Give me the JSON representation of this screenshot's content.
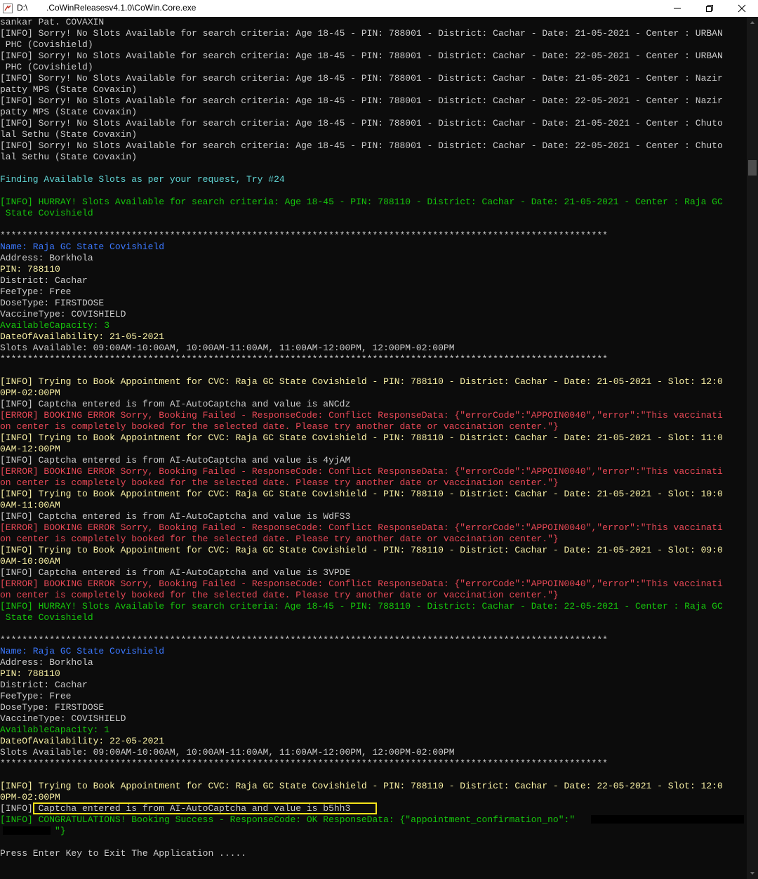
{
  "window": {
    "title": "D:\\        .CoWinReleasesv4.1.0\\CoWin.Core.exe"
  },
  "colors": {
    "background": "#0c0c0c",
    "default": "#cccccc",
    "yellow": "#f9f1a5",
    "green": "#16c60c",
    "red": "#e74856",
    "cyan": "#61d6d6",
    "blue": "#3b78ff",
    "highlight": "#f5e31a"
  },
  "console_lines": [
    {
      "t": "sankar Pat. COVAXIN",
      "c": "white"
    },
    {
      "t": "[INFO] Sorry! No Slots Available for search criteria: Age 18-45 - PIN: 788001 - District: Cachar - Date: 21-05-2021 - Center : URBAN",
      "c": "white"
    },
    {
      "t": " PHC (Covishield)",
      "c": "white"
    },
    {
      "t": "[INFO] Sorry! No Slots Available for search criteria: Age 18-45 - PIN: 788001 - District: Cachar - Date: 22-05-2021 - Center : URBAN",
      "c": "white"
    },
    {
      "t": " PHC (Covishield)",
      "c": "white"
    },
    {
      "t": "[INFO] Sorry! No Slots Available for search criteria: Age 18-45 - PIN: 788001 - District: Cachar - Date: 21-05-2021 - Center : Nazir",
      "c": "white"
    },
    {
      "t": "patty MPS (State Covaxin)",
      "c": "white"
    },
    {
      "t": "[INFO] Sorry! No Slots Available for search criteria: Age 18-45 - PIN: 788001 - District: Cachar - Date: 22-05-2021 - Center : Nazir",
      "c": "white"
    },
    {
      "t": "patty MPS (State Covaxin)",
      "c": "white"
    },
    {
      "t": "[INFO] Sorry! No Slots Available for search criteria: Age 18-45 - PIN: 788001 - District: Cachar - Date: 21-05-2021 - Center : Chuto",
      "c": "white"
    },
    {
      "t": "lal Sethu (State Covaxin)",
      "c": "white"
    },
    {
      "t": "[INFO] Sorry! No Slots Available for search criteria: Age 18-45 - PIN: 788001 - District: Cachar - Date: 22-05-2021 - Center : Chuto",
      "c": "white"
    },
    {
      "t": "lal Sethu (State Covaxin)",
      "c": "white"
    },
    {
      "t": "",
      "c": "white"
    },
    {
      "t": "Finding Available Slots as per your request, Try #24",
      "c": "cyan"
    },
    {
      "t": "",
      "c": "white"
    },
    {
      "t": "[INFO] HURRAY! Slots Available for search criteria: Age 18-45 - PIN: 788110 - District: Cachar - Date: 21-05-2021 - Center : Raja GC",
      "c": "green"
    },
    {
      "t": " State Covishield",
      "c": "green"
    },
    {
      "t": "",
      "c": "white"
    },
    {
      "t": "***************************************************************************************************************",
      "c": "white"
    },
    {
      "t": "Name: Raja GC State Covishield",
      "c": "blue"
    },
    {
      "t": "Address: Borkhola",
      "c": "white"
    },
    {
      "t": "PIN: 788110",
      "c": "yellow"
    },
    {
      "t": "District: Cachar",
      "c": "white"
    },
    {
      "t": "FeeType: Free",
      "c": "white"
    },
    {
      "t": "DoseType: FIRSTDOSE",
      "c": "white"
    },
    {
      "t": "VaccineType: COVISHIELD",
      "c": "white"
    },
    {
      "t": "AvailableCapacity: 3",
      "c": "green"
    },
    {
      "t": "DateOfAvailability: 21-05-2021",
      "c": "yellow"
    },
    {
      "t": "Slots Available: 09:00AM-10:00AM, 10:00AM-11:00AM, 11:00AM-12:00PM, 12:00PM-02:00PM",
      "c": "white"
    },
    {
      "t": "***************************************************************************************************************",
      "c": "white"
    },
    {
      "t": "",
      "c": "white"
    },
    {
      "t": "[INFO] Trying to Book Appointment for CVC: Raja GC State Covishield - PIN: 788110 - District: Cachar - Date: 21-05-2021 - Slot: 12:0",
      "c": "yellow"
    },
    {
      "t": "0PM-02:00PM",
      "c": "yellow"
    },
    {
      "t": "[INFO] Captcha entered is from AI-AutoCaptcha and value is aNCdz",
      "c": "white"
    },
    {
      "t": "[ERROR] BOOKING ERROR Sorry, Booking Failed - ResponseCode: Conflict ResponseData: {\"errorCode\":\"APPOIN0040\",\"error\":\"This vaccinati",
      "c": "red"
    },
    {
      "t": "on center is completely booked for the selected date. Please try another date or vaccination center.\"}",
      "c": "red"
    },
    {
      "t": "[INFO] Trying to Book Appointment for CVC: Raja GC State Covishield - PIN: 788110 - District: Cachar - Date: 21-05-2021 - Slot: 11:0",
      "c": "yellow"
    },
    {
      "t": "0AM-12:00PM",
      "c": "yellow"
    },
    {
      "t": "[INFO] Captcha entered is from AI-AutoCaptcha and value is 4yjAM",
      "c": "white"
    },
    {
      "t": "[ERROR] BOOKING ERROR Sorry, Booking Failed - ResponseCode: Conflict ResponseData: {\"errorCode\":\"APPOIN0040\",\"error\":\"This vaccinati",
      "c": "red"
    },
    {
      "t": "on center is completely booked for the selected date. Please try another date or vaccination center.\"}",
      "c": "red"
    },
    {
      "t": "[INFO] Trying to Book Appointment for CVC: Raja GC State Covishield - PIN: 788110 - District: Cachar - Date: 21-05-2021 - Slot: 10:0",
      "c": "yellow"
    },
    {
      "t": "0AM-11:00AM",
      "c": "yellow"
    },
    {
      "t": "[INFO] Captcha entered is from AI-AutoCaptcha and value is WdFS3",
      "c": "white"
    },
    {
      "t": "[ERROR] BOOKING ERROR Sorry, Booking Failed - ResponseCode: Conflict ResponseData: {\"errorCode\":\"APPOIN0040\",\"error\":\"This vaccinati",
      "c": "red"
    },
    {
      "t": "on center is completely booked for the selected date. Please try another date or vaccination center.\"}",
      "c": "red"
    },
    {
      "t": "[INFO] Trying to Book Appointment for CVC: Raja GC State Covishield - PIN: 788110 - District: Cachar - Date: 21-05-2021 - Slot: 09:0",
      "c": "yellow"
    },
    {
      "t": "0AM-10:00AM",
      "c": "yellow"
    },
    {
      "t": "[INFO] Captcha entered is from AI-AutoCaptcha and value is 3VPDE",
      "c": "white"
    },
    {
      "t": "[ERROR] BOOKING ERROR Sorry, Booking Failed - ResponseCode: Conflict ResponseData: {\"errorCode\":\"APPOIN0040\",\"error\":\"This vaccinati",
      "c": "red"
    },
    {
      "t": "on center is completely booked for the selected date. Please try another date or vaccination center.\"}",
      "c": "red"
    },
    {
      "t": "[INFO] HURRAY! Slots Available for search criteria: Age 18-45 - PIN: 788110 - District: Cachar - Date: 22-05-2021 - Center : Raja GC",
      "c": "green"
    },
    {
      "t": " State Covishield",
      "c": "green"
    },
    {
      "t": "",
      "c": "white"
    },
    {
      "t": "***************************************************************************************************************",
      "c": "white"
    },
    {
      "t": "Name: Raja GC State Covishield",
      "c": "blue"
    },
    {
      "t": "Address: Borkhola",
      "c": "white"
    },
    {
      "t": "PIN: 788110",
      "c": "yellow"
    },
    {
      "t": "District: Cachar",
      "c": "white"
    },
    {
      "t": "FeeType: Free",
      "c": "white"
    },
    {
      "t": "DoseType: FIRSTDOSE",
      "c": "white"
    },
    {
      "t": "VaccineType: COVISHIELD",
      "c": "white"
    },
    {
      "t": "AvailableCapacity: 1",
      "c": "green"
    },
    {
      "t": "DateOfAvailability: 22-05-2021",
      "c": "yellow"
    },
    {
      "t": "Slots Available: 09:00AM-10:00AM, 10:00AM-11:00AM, 11:00AM-12:00PM, 12:00PM-02:00PM",
      "c": "white"
    },
    {
      "t": "***************************************************************************************************************",
      "c": "white"
    },
    {
      "t": "",
      "c": "white"
    },
    {
      "t": "[INFO] Trying to Book Appointment for CVC: Raja GC State Covishield - PIN: 788110 - District: Cachar - Date: 22-05-2021 - Slot: 12:0",
      "c": "yellow"
    },
    {
      "t": "0PM-02:00PM",
      "c": "yellow"
    },
    {
      "t": "[INFO] Captcha entered is from AI-AutoCaptcha and value is b5hh3",
      "c": "white"
    },
    {
      "t": "[INFO] CONGRATULATIONS! Booking Success - ResponseCode: OK ResponseData: {\"appointment_confirmation_no\":\"",
      "c": "green"
    },
    {
      "t": "          \"}",
      "c": "green"
    },
    {
      "t": "",
      "c": "white"
    },
    {
      "t": "Press Enter Key to Exit The Application .....",
      "c": "white"
    }
  ]
}
